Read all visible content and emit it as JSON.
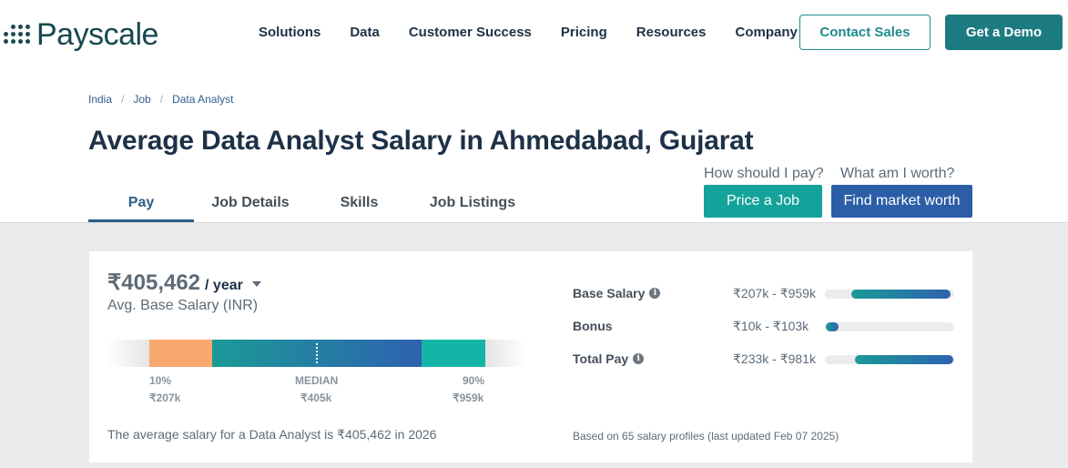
{
  "nav": {
    "brand": "Payscale",
    "menu": [
      "Solutions",
      "Data",
      "Customer Success",
      "Pricing",
      "Resources",
      "Company"
    ],
    "contact_label": "Contact Sales",
    "demo_label": "Get a Demo"
  },
  "breadcrumbs": [
    "India",
    "Job",
    "Data Analyst"
  ],
  "page_title": "Average Data Analyst Salary in Ahmedabad, Gujarat",
  "cta": {
    "pay_question": "How should I pay?",
    "worth_question": "What am I worth?",
    "price_label": "Price a Job",
    "worth_label": "Find market worth"
  },
  "tabs": [
    "Pay",
    "Job Details",
    "Skills",
    "Job Listings"
  ],
  "salary": {
    "amount": "₹405,462",
    "period": "/ year",
    "subtitle": "Avg. Base Salary (INR)",
    "p10_pct": "10%",
    "p10_value": "₹207k",
    "median_label": "MEDIAN",
    "median_value": "₹405k",
    "p90_pct": "90%",
    "p90_value": "₹959k",
    "summary": "The average salary for a Data Analyst is ₹405,462 in 2026"
  },
  "pay_rows": [
    {
      "name": "Base Salary",
      "range": "₹207k - ₹959k",
      "has_info": true
    },
    {
      "name": "Bonus",
      "range": "₹10k - ₹103k",
      "has_info": false
    },
    {
      "name": "Total Pay",
      "range": "₹233k - ₹981k",
      "has_info": true
    }
  ],
  "basis_note": "Based on 65 salary profiles (last updated Feb 07 2025)",
  "colors": {
    "teal": "#1c7b80",
    "blue": "#2c5ea8",
    "p10": "#f9a86e",
    "p90": "#14b5a6"
  }
}
